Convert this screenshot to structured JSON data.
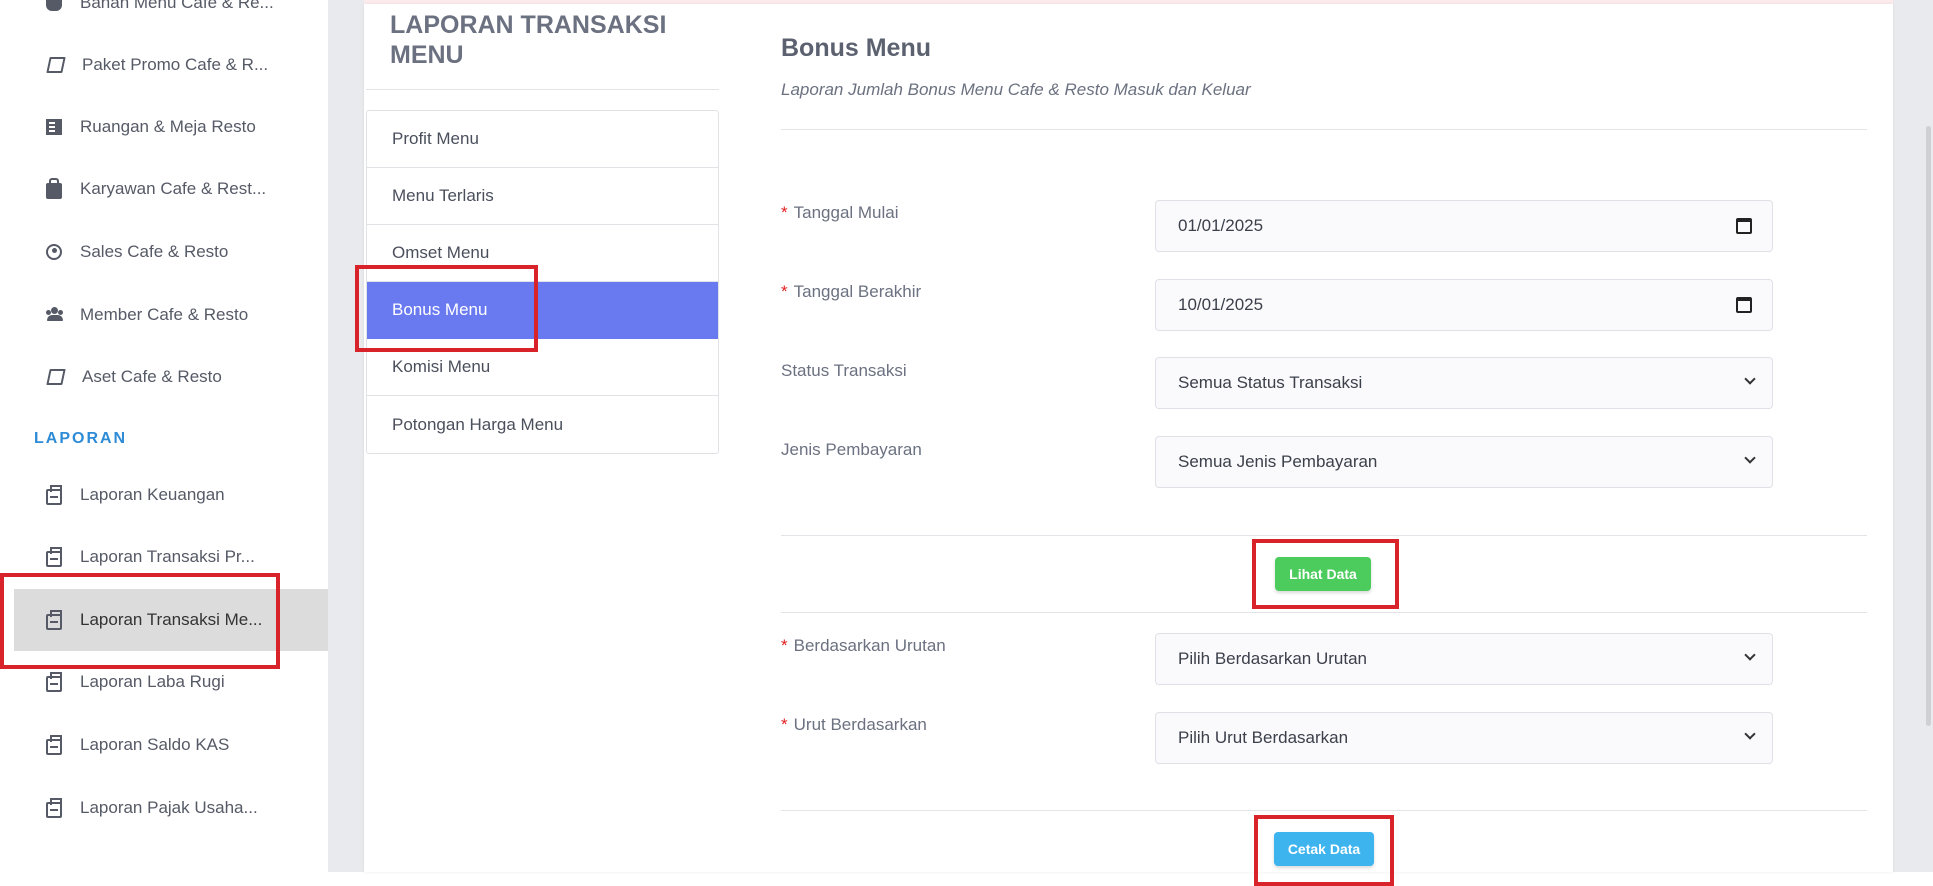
{
  "sidebar": {
    "items": [
      {
        "label": "Bahan Menu Cafe & Re...",
        "icon": "cogs-icon"
      },
      {
        "label": "Paket Promo Cafe & R...",
        "icon": "book-icon"
      },
      {
        "label": "Ruangan & Meja Resto",
        "icon": "building-icon"
      },
      {
        "label": "Karyawan Cafe & Rest...",
        "icon": "briefcase-icon"
      },
      {
        "label": "Sales Cafe & Resto",
        "icon": "user-circle-icon"
      },
      {
        "label": "Member Cafe & Resto",
        "icon": "users-icon"
      },
      {
        "label": "Aset Cafe & Resto",
        "icon": "book-icon"
      }
    ],
    "section": "LAPORAN",
    "report_items": [
      {
        "label": "Laporan Keuangan",
        "icon": "print-icon"
      },
      {
        "label": "Laporan Transaksi Pr...",
        "icon": "print-icon"
      },
      {
        "label": "Laporan Transaksi Me...",
        "icon": "print-icon",
        "active": true
      },
      {
        "label": "Laporan Laba Rugi",
        "icon": "print-icon"
      },
      {
        "label": "Laporan Saldo KAS",
        "icon": "print-icon"
      },
      {
        "label": "Laporan Pajak Usaha...",
        "icon": "print-icon"
      }
    ]
  },
  "report_panel": {
    "title": "LAPORAN TRANSAKSI MENU",
    "menu": [
      "Profit Menu",
      "Menu Terlaris",
      "Omset Menu",
      "Bonus Menu",
      "Komisi Menu",
      "Potongan Harga Menu"
    ],
    "active_index": 3
  },
  "form": {
    "title": "Bonus Menu",
    "subtitle": "Laporan Jumlah Bonus Menu Cafe & Resto Masuk dan Keluar",
    "required_mark": "*",
    "tanggal_mulai": {
      "label": "Tanggal Mulai",
      "value": "01/01/2025"
    },
    "tanggal_berakhir": {
      "label": "Tanggal Berakhir",
      "value": "10/01/2025"
    },
    "status_transaksi": {
      "label": "Status Transaksi",
      "value": "Semua Status Transaksi"
    },
    "jenis_pembayaran": {
      "label": "Jenis Pembayaran",
      "value": "Semua Jenis Pembayaran"
    },
    "lihat_button": "Lihat Data",
    "berdasarkan_urutan": {
      "label": "Berdasarkan Urutan",
      "value": "Pilih Berdasarkan Urutan"
    },
    "urut_berdasarkan": {
      "label": "Urut Berdasarkan",
      "value": "Pilih Urut Berdasarkan"
    },
    "cetak_button": "Cetak Data"
  },
  "colors": {
    "active_menu": "#6979f0",
    "green_button": "#4ccc5c",
    "blue_button": "#3db4ee",
    "section_heading": "#2e8bd6",
    "highlight": "#d8232a"
  }
}
